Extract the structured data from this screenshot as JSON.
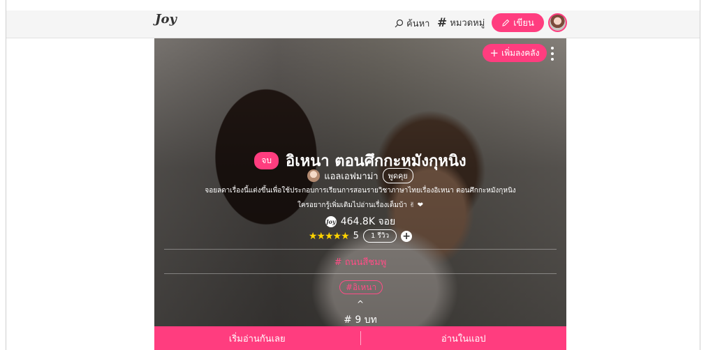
{
  "header": {
    "logo": "Joy",
    "search_label": "ค้นหา",
    "category_label": "หมวดหมู่",
    "write_label": "เขียน"
  },
  "hero": {
    "add_to_shelf_label": "เพิ่มลงคลัง",
    "status_badge": "จบ",
    "title": "อิเหนา ตอนศึกกะหมังกุหนิง",
    "author": "แอลเอฟมาม่า",
    "talk_label": "พูดคุย",
    "description_line1": "จอยลดาเรื่องนี้แต่งขึ้นเพื่อใช้ประกอบการเรียนการสอนรายวิชาภาษาไทยเรื่องอิเหนา ตอนศึกกะหมังกุหนิง",
    "description_line2": "ใครอยากรู้เพิ่มเติมไปอ่านเรื่องเต็มบ้า ✌ ❤",
    "views": "464.8K จอย",
    "stars": "★★★★★",
    "rating_value": "5",
    "reviews_label": "1 รีวิว",
    "tagline": "# ถนนสีชมพู",
    "tag": "#อิเหนา",
    "caret": "^",
    "chapters": "# 9 บท"
  },
  "cta": {
    "start_reading": "เริ่มอ่านกันเลย",
    "read_in_app": "อ่านในแอป"
  },
  "colors": {
    "accent": "#ff3d7f",
    "star": "#ffd400"
  }
}
